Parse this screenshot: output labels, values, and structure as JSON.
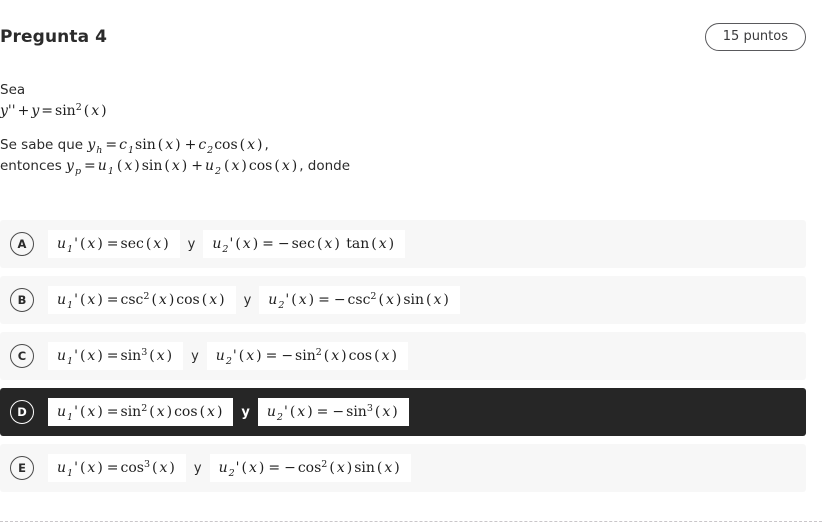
{
  "header": {
    "title": "Pregunta 4",
    "points_badge": "15 puntos"
  },
  "stem": {
    "line1": "Sea",
    "equation": "y'' + y = sin²(x)",
    "line2_prefix": "Se sabe que",
    "line2_math": "y_h = c_1 sin(x) + c_2 cos(x)",
    "line2_suffix": ",",
    "line3_prefix": "entonces",
    "line3_math": "y_p = u_1(x) sin(x) + u_2(x) cos(x)",
    "line3_suffix": ", donde"
  },
  "options": [
    {
      "letter": "A",
      "selected": false,
      "left_math": "u_1'(x) = sec(x)",
      "conjunction": "y",
      "right_math": "u_2'(x) = − sec(x) tan(x)"
    },
    {
      "letter": "B",
      "selected": false,
      "left_math": "u_1'(x) = csc²(x) cos(x)",
      "conjunction": "y",
      "right_math": "u_2'(x) = − csc²(x) sin(x)"
    },
    {
      "letter": "C",
      "selected": false,
      "left_math": "u_1'(x) = sin³(x)",
      "conjunction": "y",
      "right_math": "u_2'(x) = − sin²(x) cos(x)"
    },
    {
      "letter": "D",
      "selected": true,
      "left_math": "u_1'(x) = sin²(x) cos(x)",
      "conjunction": "y",
      "right_math": "u_2'(x) = − sin³(x)"
    },
    {
      "letter": "E",
      "selected": false,
      "left_math": "u_1'(x) = cos³(x)",
      "conjunction": "y",
      "right_math": "u_2'(x) = − cos²(x) sin(x)"
    }
  ],
  "colors": {
    "row_background": "#f7f7f7",
    "selected_row_background": "#262626",
    "text": "#2b2b2b",
    "page_background": "#ffffff",
    "dashed_rule": "#c9c6c9"
  }
}
